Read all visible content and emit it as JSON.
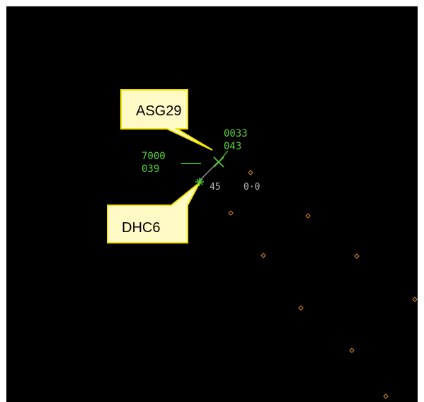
{
  "colors": {
    "background": "#000000",
    "target_green": "#5ad13a",
    "label_grey": "#b8b8b8",
    "map_marker_orange": "#d98a2a",
    "callout_fill": "#fff9c6",
    "callout_border": "#f5e400"
  },
  "callouts": [
    {
      "label": "ASG29"
    },
    {
      "label": "DHC6"
    }
  ],
  "targets": [
    {
      "id": "asg29-track",
      "symbol": "x",
      "data_block": {
        "line1": "0033",
        "line2": "043"
      }
    },
    {
      "id": "dhc6-track",
      "symbol": "star",
      "data_block": {
        "alt": "45",
        "vector": "0·0"
      }
    },
    {
      "id": "left-tag",
      "data_block": {
        "line1": "7000",
        "line2": "039"
      }
    }
  ],
  "map_markers_count_visible": 9,
  "icons": {
    "x_target": "x-target-icon",
    "star_target": "asterisk-target-icon",
    "map_marker": "diamond-marker-icon"
  }
}
